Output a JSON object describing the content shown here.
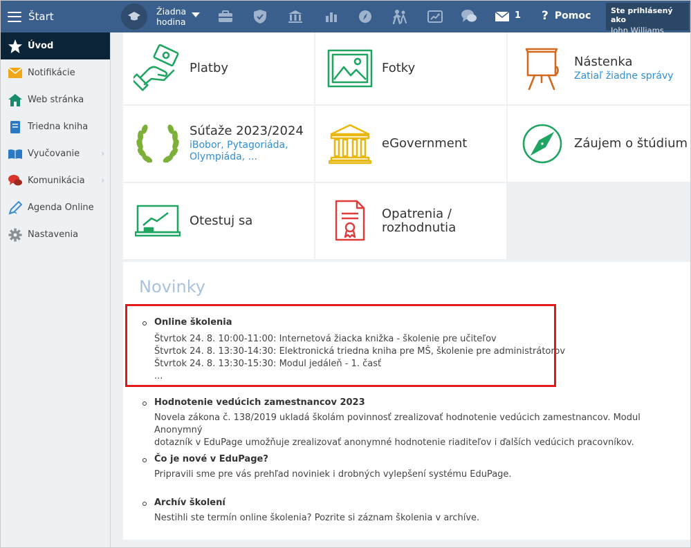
{
  "topbar": {
    "start_label": "Štart",
    "period_line1": "Žiadna",
    "period_line2": "hodina",
    "message_count": "1",
    "help_label": "Pomoc",
    "user_label": "Ste prihlásený ako",
    "user_name": "John Williams",
    "icons": [
      "graduation-cap-icon",
      "briefcase-icon",
      "shield-icon",
      "bank-icon",
      "bar-chart-icon",
      "compass-icon",
      "people-icon",
      "cast-icon",
      "chat-icon",
      "envelope-icon"
    ]
  },
  "sidebar": {
    "items": [
      {
        "label": "Úvod",
        "icon": "star-icon",
        "active": true
      },
      {
        "label": "Notifikácie",
        "icon": "envelope-icon"
      },
      {
        "label": "Web stránka",
        "icon": "home-icon"
      },
      {
        "label": "Triedna kniha",
        "icon": "book-icon"
      },
      {
        "label": "Vyučovanie",
        "icon": "open-book-icon",
        "has_submenu": true
      },
      {
        "label": "Komunikácia",
        "icon": "chat-icon",
        "has_submenu": true
      },
      {
        "label": "Agenda Online",
        "icon": "pen-icon"
      },
      {
        "label": "Nastavenia",
        "icon": "gear-icon"
      }
    ]
  },
  "tiles": [
    {
      "title": "Platby",
      "subtitle": "",
      "icon": "money-hand-icon",
      "color": "#1fa561"
    },
    {
      "title": "Fotky",
      "subtitle": "",
      "icon": "picture-icon",
      "color": "#1fa561"
    },
    {
      "title": "Nástenka",
      "subtitle": "Zatiaľ žiadne správy",
      "icon": "board-icon",
      "color": "#d2691e"
    },
    {
      "title": "Súťaže 2023/2024",
      "subtitle": "iBobor, Pytagoriáda, Olympiáda, ...",
      "icon": "laurel-icon",
      "color": "#7db038"
    },
    {
      "title": "eGovernment",
      "subtitle": "",
      "icon": "government-building-icon",
      "color": "#e8b810"
    },
    {
      "title": "Záujem o štúdium",
      "subtitle": "",
      "icon": "compass-icon",
      "color": "#1fa561"
    },
    {
      "title": "Otestuj sa",
      "subtitle": "",
      "icon": "chalkboard-icon",
      "color": "#1fa561"
    },
    {
      "title": "Opatrenia / rozhodnutia",
      "subtitle": "",
      "icon": "certificate-icon",
      "color": "#e03b3b"
    }
  ],
  "news": {
    "heading": "Novinky",
    "items": [
      {
        "title": "Online školenia",
        "lines": [
          "Štvrtok 24. 8. 10:00-11:00: Internetová žiacka knižka - školenie pre učiteľov",
          "Štvrtok 24. 8. 13:30-14:30: Elektronická triedna kniha pre MŠ, školenie pre administrátorov",
          "Štvrtok 24. 8. 13:30-15:30: Modul jedáleň - 1. časť",
          "..."
        ]
      },
      {
        "title": "Hodnotenie vedúcich zamestnancov 2023",
        "lines": [
          "Novela zákona č. 138/2019 ukladá školám povinnosť zrealizovať hodnotenie vedúcich zamestnancov. Modul Anonymný",
          "dotazník v EduPage umožňuje zrealizovať anonymné hodnotenie riaditeľov i ďalších vedúcich pracovníkov."
        ]
      },
      {
        "title": "Čo je nové v EduPage?",
        "lines": [
          "Pripravili sme pre vás prehľad noviniek i drobných vylepšení systému EduPage."
        ]
      },
      {
        "title": "Archív školení",
        "lines": [
          "Nestihli ste termín online školenia? Pozrite si záznam školenia v archíve."
        ]
      }
    ]
  },
  "colors": {
    "topbar": "#3a5f8c",
    "active_sidebar": "#0c2437",
    "link": "#2f8fd6",
    "highlight": "#e11919"
  }
}
